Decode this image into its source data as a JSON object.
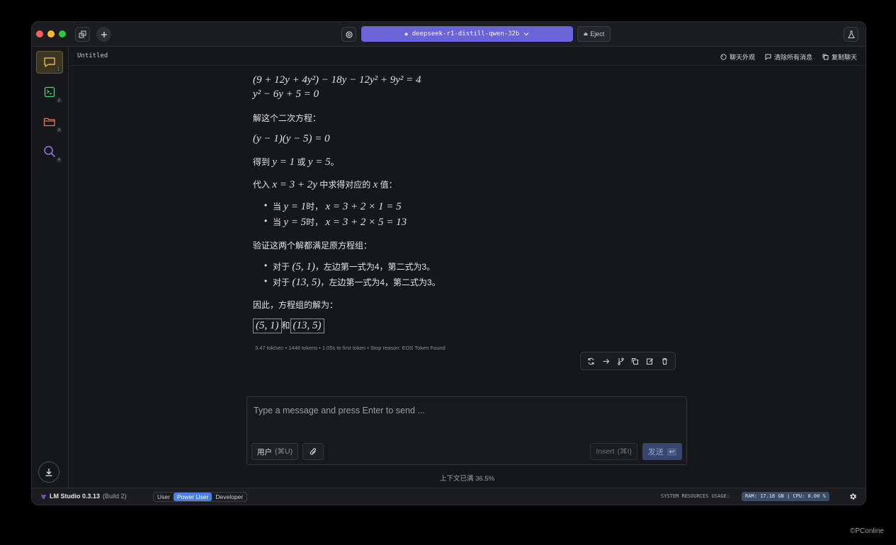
{
  "titlebar": {
    "model_name": "deepseek-r1-distill-qwen-32b",
    "eject_label": "Eject"
  },
  "sidebar": {
    "items": [
      {
        "icon": "chat-bubble-icon",
        "num": "1",
        "color": "#e8b84a"
      },
      {
        "icon": "terminal-icon",
        "num": "2",
        "color": "#4fcf7c"
      },
      {
        "icon": "folder-icon",
        "num": "3",
        "color": "#e27a5a"
      },
      {
        "icon": "search-icon",
        "num": "4",
        "color": "#a070ee"
      }
    ]
  },
  "header": {
    "title": "Untitled",
    "actions": [
      "聊天外观",
      "清除所有消息",
      "复制聊天"
    ]
  },
  "message": {
    "l1": "(9 + 12y + 4y²) − 18y − 12y² + 9y² = 4",
    "l2": "y² − 6y + 5 = 0",
    "l3": "解这个二次方程：",
    "l4": "(y − 1)(y − 5) = 0",
    "l5_a": "得到",
    "l5_b": "y = 1",
    "l5_c": "或",
    "l5_d": "y = 5",
    "l5_e": "。",
    "l6_a": "代入",
    "l6_b": "x = 3 + 2y",
    "l6_c": "中求得对应的",
    "l6_d": "x",
    "l6_e": "值：",
    "b1_a": "当",
    "b1_b": "y = 1",
    "b1_c": "时，",
    "b1_d": "x = 3 + 2 × 1 = 5",
    "b2_a": "当",
    "b2_b": "y = 5",
    "b2_c": "时，",
    "b2_d": "x = 3 + 2 × 5 = 13",
    "l7": "验证这两个解都满足原方程组：",
    "b3_a": "对于",
    "b3_b": "(5, 1)",
    "b3_c": "，左边第一式为4，第二式为3。",
    "b4_a": "对于",
    "b4_b": "(13, 5)",
    "b4_c": "，左边第一式为4，第二式为3。",
    "l8": "因此，方程组的解为：",
    "ans_1": "(5, 1)",
    "ans_and": "和",
    "ans_2": "(13, 5)",
    "stats": "3.47 tok/sec • 1448 tokens • 1.05s to first token • Stop reason: EOS Token Found"
  },
  "input": {
    "placeholder": "Type a message and press Enter to send ...",
    "role_label": "用户",
    "role_shortcut": "(⌘U)",
    "insert_label": "Insert",
    "insert_shortcut": "(⌘I)",
    "send_label": "发送",
    "send_key": "↩",
    "context_full": "上下文已满 36.5%"
  },
  "status": {
    "app_name": "LM Studio 0.3.13",
    "app_build": "(Build 2)",
    "modes": [
      "User",
      "Power User",
      "Developer"
    ],
    "active_mode": "Power User",
    "resources_label": "SYSTEM RESOURCES USAGE:",
    "resources_value": "RAM: 17.18 GB  |  CPU: 0.00 %"
  },
  "watermark": "PConline",
  "colors": {
    "accent": "#6a64d8",
    "mode_active": "#4b7fe6"
  }
}
